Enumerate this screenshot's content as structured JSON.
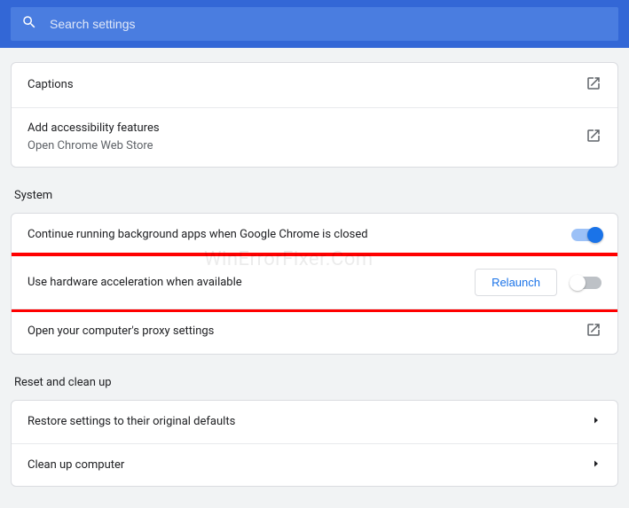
{
  "search": {
    "placeholder": "Search settings"
  },
  "accessibility": {
    "captions": "Captions",
    "add_title": "Add accessibility features",
    "add_sub": "Open Chrome Web Store"
  },
  "system": {
    "header": "System",
    "bg_apps": "Continue running background apps when Google Chrome is closed",
    "hw_accel": "Use hardware acceleration when available",
    "relaunch": "Relaunch",
    "proxy": "Open your computer's proxy settings"
  },
  "reset": {
    "header": "Reset and clean up",
    "restore": "Restore settings to their original defaults",
    "cleanup": "Clean up computer"
  },
  "watermark": "WinErrorFixer.Com"
}
